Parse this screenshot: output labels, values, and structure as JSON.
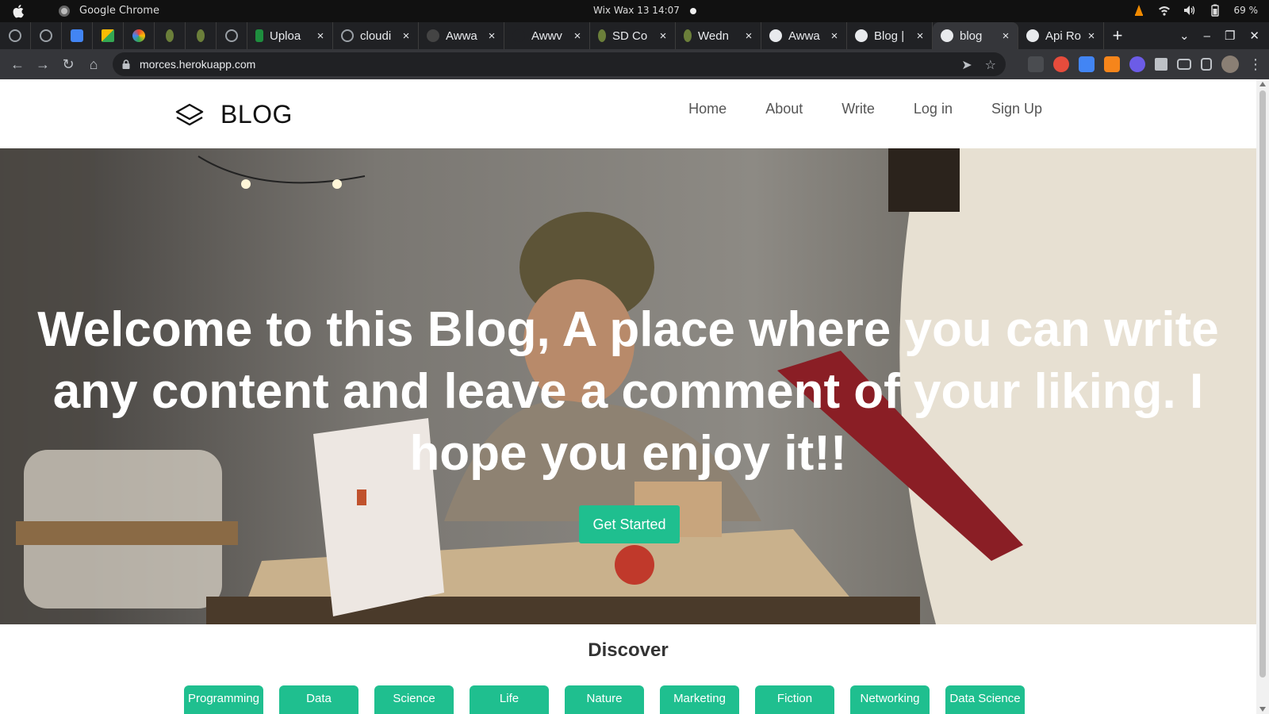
{
  "os": {
    "app_name": "Google Chrome",
    "clock": "Wix Wax 13  14:07",
    "battery": "69 %"
  },
  "browser": {
    "tabs": [
      {
        "label": "Uploa",
        "favicon_color": "#1e8e3e"
      },
      {
        "label": "cloudi",
        "favicon_color": "#555555"
      },
      {
        "label": "Awwa",
        "favicon_color": "#444444"
      },
      {
        "label": "Awwv",
        "favicon_color": "#202124"
      },
      {
        "label": "SD Co",
        "favicon_color": "#6b7f3a"
      },
      {
        "label": "Wedn",
        "favicon_color": "#6b7f3a"
      },
      {
        "label": "Awwa",
        "favicon_color": "#e8eaed"
      },
      {
        "label": "Blog |",
        "favicon_color": "#e8eaed"
      },
      {
        "label": "blog",
        "favicon_color": "#e8eaed",
        "active": true
      },
      {
        "label": "Api Ro",
        "favicon_color": "#e8eaed"
      }
    ],
    "close_glyph": "×",
    "new_tab_glyph": "+",
    "url": "morces.herokuapp.com"
  },
  "site": {
    "brand": "BLOG",
    "nav": [
      "Home",
      "About",
      "Write",
      "Log in",
      "Sign Up"
    ],
    "hero_title": "Welcome to this Blog, A place where you can write any content and leave a comment of your liking. I hope you enjoy it!!",
    "cta_label": "Get Started",
    "discover_title": "Discover",
    "categories": [
      "Programming",
      "Data Structures",
      "Science",
      "Life",
      "Nature",
      "Marketing",
      "Fiction",
      "Networking",
      "Data Science"
    ],
    "accent_color": "#1fbf8f"
  }
}
